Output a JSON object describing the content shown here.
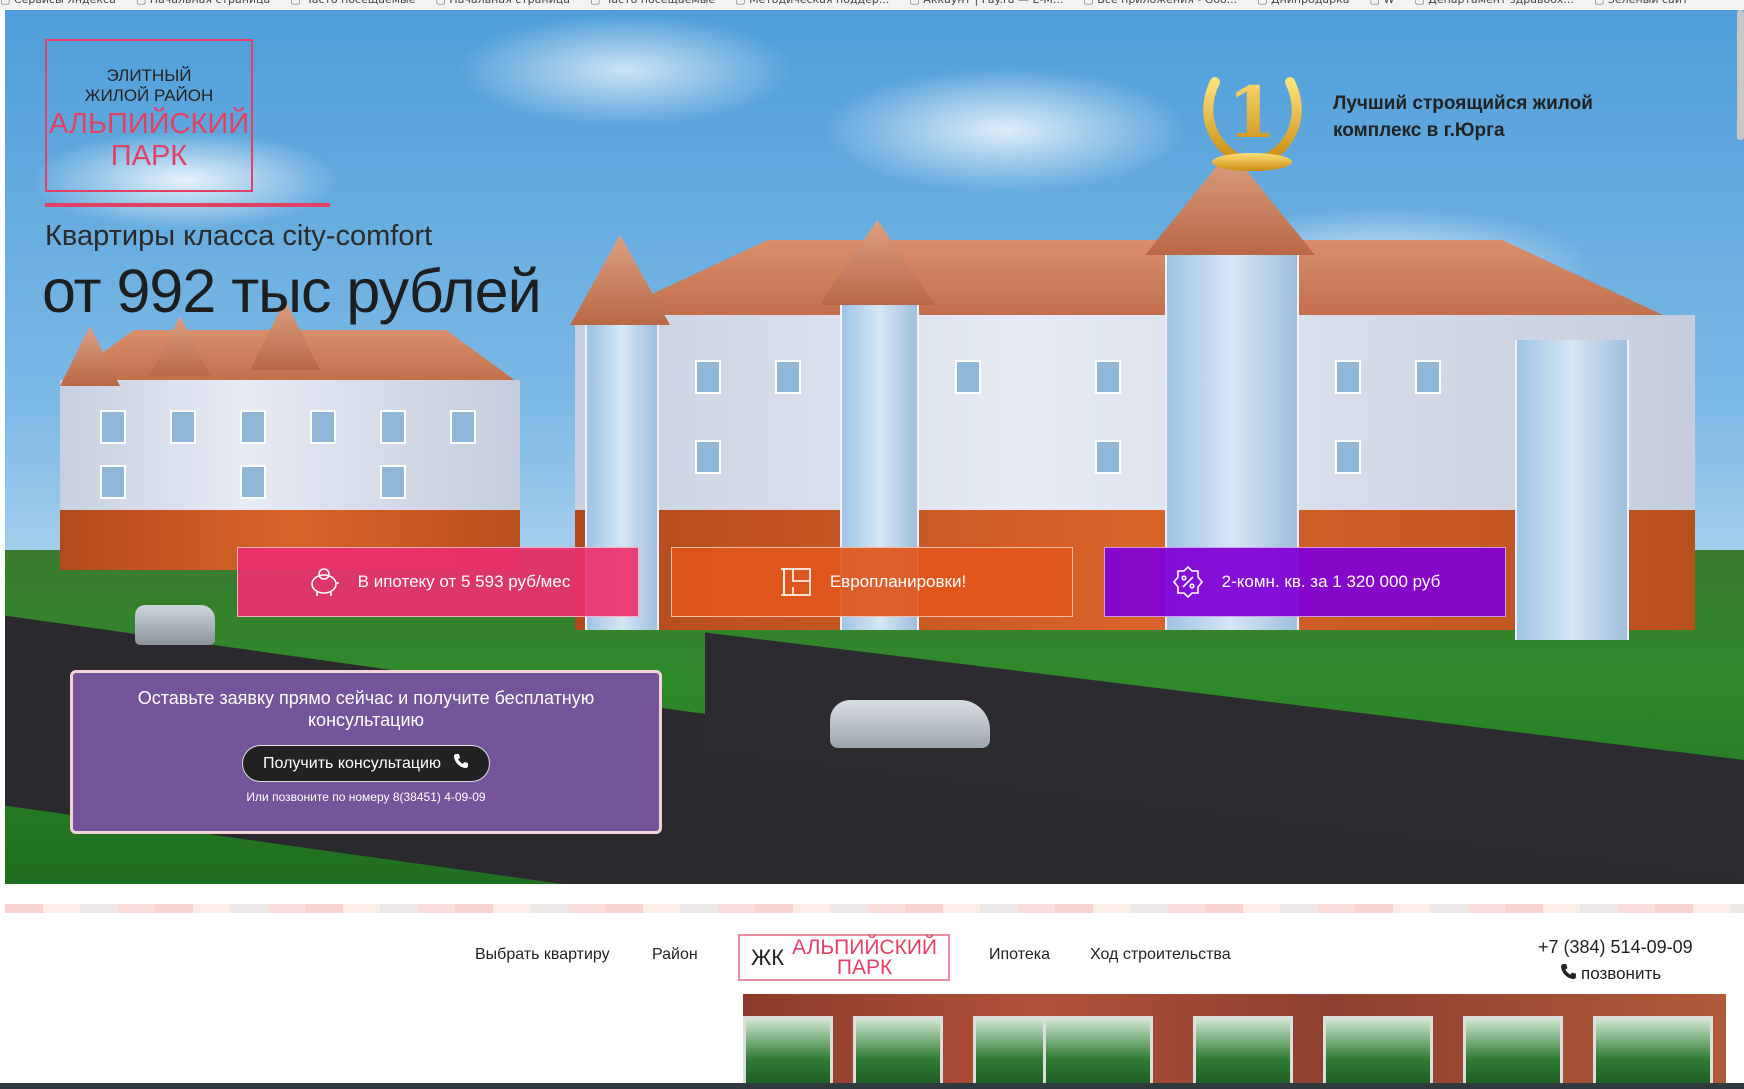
{
  "bookmarks": [
    "Сервисы Яндекса",
    "Начальная страница",
    "Часто посещаемые",
    "Начальная страница",
    "Часто посещаемые",
    "Методическая поддер...",
    "Аккаунт | Pay.ru — Е-М...",
    "Все приложения - Goo...",
    "Днипродарка",
    "W",
    "Департамент здравоох...",
    "Зеленый сайт"
  ],
  "logo": {
    "line1": "ЭЛИТНЫЙ",
    "line2": "ЖИЛОЙ РАЙОН",
    "name1": "АЛЬПИЙСКИЙ",
    "name2": "ПАРК"
  },
  "hero": {
    "subtitle": "Квартиры класса city-comfort",
    "price": "от 992 тыс рублей",
    "award_number": "1",
    "award_line1": "Лучший строящийся жилой",
    "award_line2": "комплекс в г.Юрга"
  },
  "features": [
    {
      "label": "В ипотеку от 5 593 руб/мес",
      "icon": "piggy-bank-icon"
    },
    {
      "label": "Европланировки!",
      "icon": "floor-plan-icon"
    },
    {
      "label": "2-комн. кв. за 1 320 000 руб",
      "icon": "discount-badge-icon"
    }
  ],
  "consult": {
    "text": "Оставьте заявку прямо сейчас и получите бесплатную консультацию",
    "button": "Получить консультацию",
    "note": "Или позвоните по номеру 8(38451) 4-09-09"
  },
  "nav": {
    "items": [
      "Выбрать квартиру",
      "Район",
      "Ипотека",
      "Ход строительства"
    ],
    "logo_zk": "ЖК",
    "logo_name1": "АЛЬПИЙСКИЙ",
    "logo_name2": "ПАРК",
    "phone": "+7 (384) 514-09-09",
    "call": "позвонить"
  },
  "colors": {
    "accent": "#e24163",
    "feature_pink": "#ec306e",
    "feature_orange": "#e1561c",
    "feature_purple": "#8000d6",
    "consult_bg": "#74549a"
  }
}
